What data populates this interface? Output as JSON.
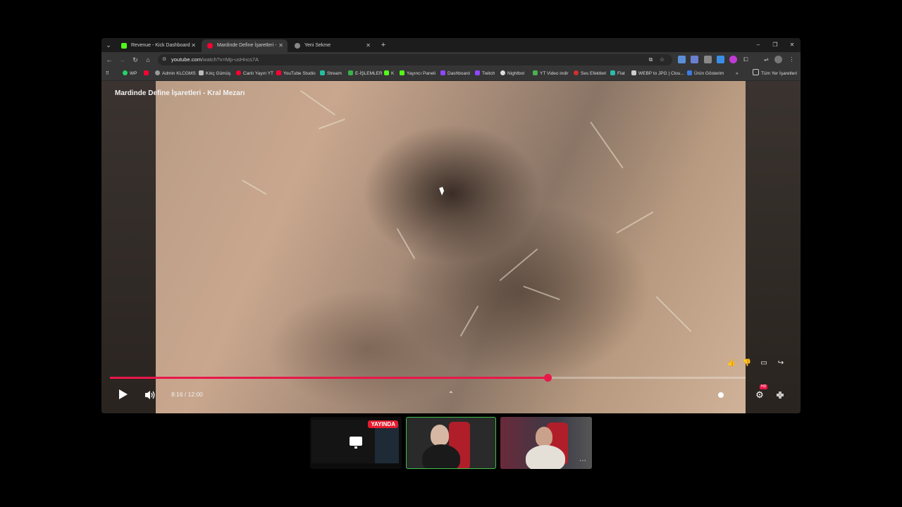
{
  "browser": {
    "tabs": [
      {
        "title": "Revenue - Kick Dashboard",
        "color": "#53fc18"
      },
      {
        "title": "Mardinde Define İşaretleri - ",
        "color": "#ff0033"
      },
      {
        "title": "Yeni Sekme",
        "color": "#888888"
      }
    ],
    "new_tab": "+",
    "url_host": "youtube.com",
    "url_path": "/watch?v=Mp-usHncs7A",
    "bookmarks": [
      "WP",
      "",
      "Admin KLCGMS",
      "Kılıç Gümüş",
      "Canlı Yayın YT",
      "YouTube Studio",
      "Stream",
      "E-İŞLEMLER",
      "K",
      "Yayıncı Paneli",
      "Dashboard",
      "Twitch",
      "Nightbot",
      "YT Video indir",
      "Ses Efektleri",
      "Flat",
      "WEBP to JPG | Clou...",
      "Ürün Gösterim"
    ],
    "bookmarks_overflow": "»",
    "all_bookmarks": "Tüm Yer İşaretleri"
  },
  "player": {
    "title": "Mardinde Define İşaretleri - Kral Mezarı",
    "current_time": "8:16",
    "duration": "12:00",
    "time_display": "8:16 / 12:00",
    "progress": 0.6886,
    "hd_badge": "HD"
  },
  "stream": {
    "live_label": "YAYINDA",
    "more_label": "⋯"
  }
}
